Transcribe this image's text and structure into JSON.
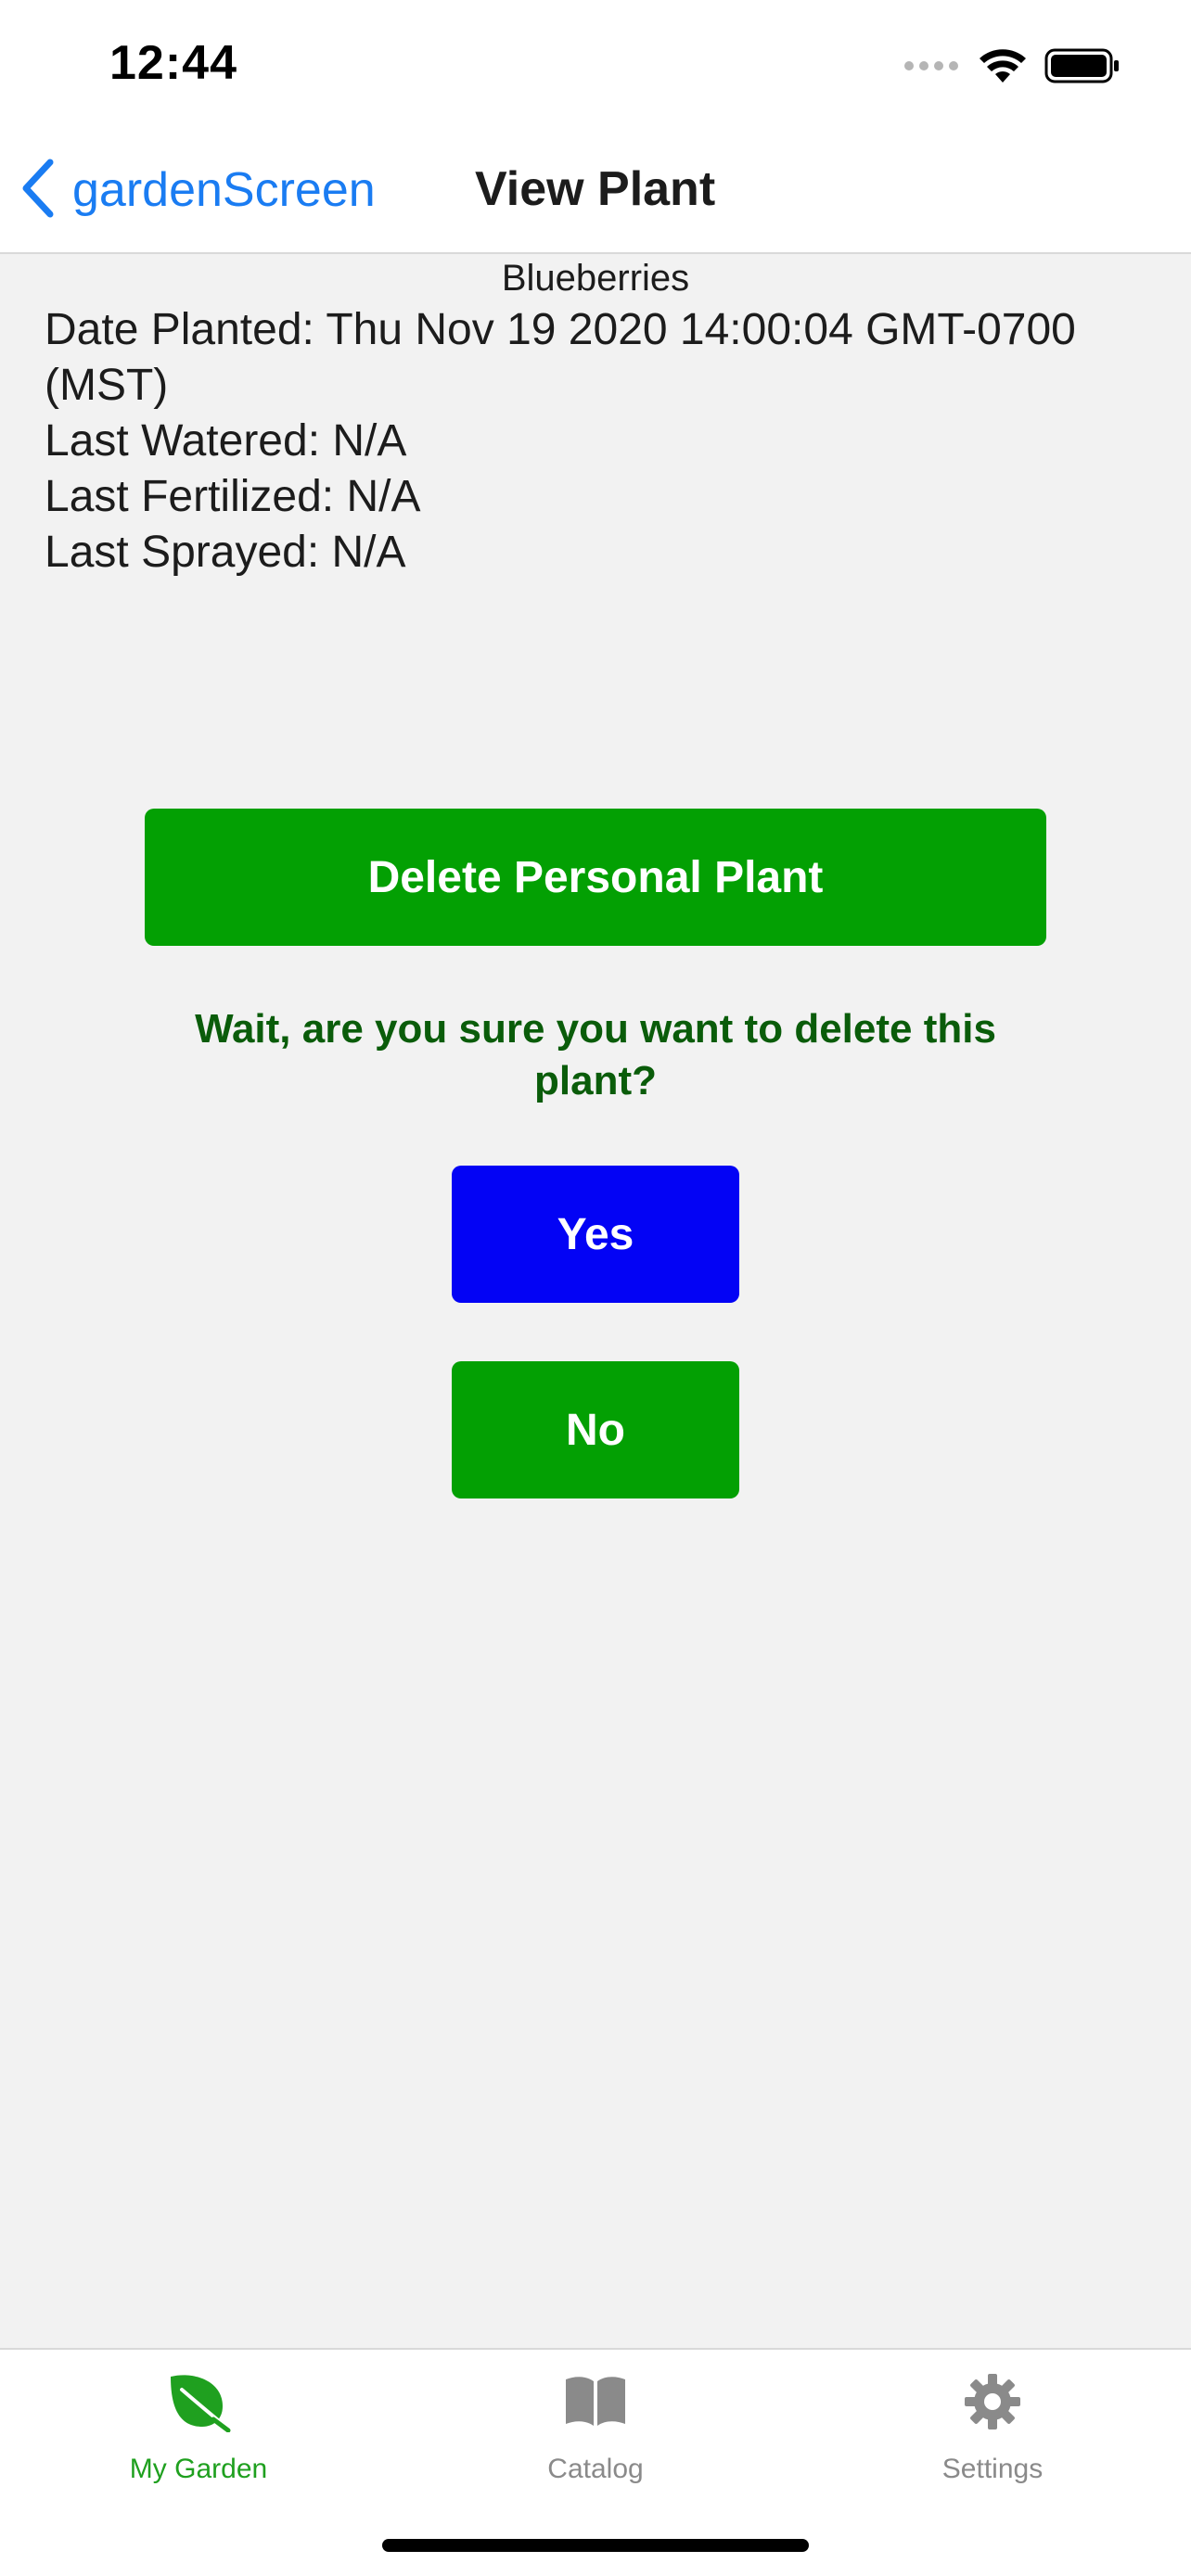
{
  "status_bar": {
    "time": "12:44"
  },
  "nav": {
    "back_label": "gardenScreen",
    "title": "View Plant"
  },
  "plant": {
    "name": "Blueberries",
    "date_planted": "Date Planted: Thu Nov 19 2020 14:00:04 GMT-0700 (MST)",
    "last_watered": "Last Watered: N/A",
    "last_fertilized": "Last Fertilized: N/A",
    "last_sprayed": "Last Sprayed: N/A"
  },
  "actions": {
    "delete_label": "Delete Personal Plant",
    "confirm_text": "Wait, are you sure you want to delete this plant?",
    "yes_label": "Yes",
    "no_label": "No"
  },
  "tabs": [
    {
      "label": "My Garden",
      "icon": "leaf-icon",
      "active": true
    },
    {
      "label": "Catalog",
      "icon": "book-icon",
      "active": false
    },
    {
      "label": "Settings",
      "icon": "gear-icon",
      "active": false
    }
  ],
  "colors": {
    "accent_blue": "#1a7cf2",
    "tab_active": "#1fa01f",
    "tab_inactive": "#8a8a8a",
    "delete_button": "#03a003",
    "yes_button": "#0303f5",
    "no_button": "#03a003",
    "confirm_text": "#0a5c0a"
  }
}
